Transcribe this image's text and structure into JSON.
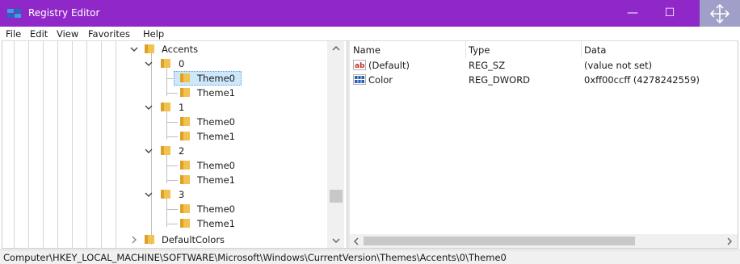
{
  "window": {
    "title": "Registry Editor",
    "accent_color": "#8f27c9",
    "controls": {
      "minimize": "—",
      "maximize": "☐"
    }
  },
  "menu": [
    "File",
    "Edit",
    "View",
    "Favorites",
    "Help"
  ],
  "tree": {
    "items": [
      {
        "label": "Accents",
        "depth": 0,
        "expanded": true
      },
      {
        "label": "0",
        "depth": 1,
        "expanded": true
      },
      {
        "label": "Theme0",
        "depth": 2,
        "selected": true
      },
      {
        "label": "Theme1",
        "depth": 2
      },
      {
        "label": "1",
        "depth": 1,
        "expanded": true
      },
      {
        "label": "Theme0",
        "depth": 2
      },
      {
        "label": "Theme1",
        "depth": 2
      },
      {
        "label": "2",
        "depth": 1,
        "expanded": true
      },
      {
        "label": "Theme0",
        "depth": 2
      },
      {
        "label": "Theme1",
        "depth": 2
      },
      {
        "label": "3",
        "depth": 1,
        "expanded": true
      },
      {
        "label": "Theme0",
        "depth": 2
      },
      {
        "label": "Theme1",
        "depth": 2
      },
      {
        "label": "DefaultColors",
        "depth": 0,
        "expanded": false
      }
    ]
  },
  "list": {
    "columns": [
      "Name",
      "Type",
      "Data"
    ],
    "rows": [
      {
        "icon": "string-value-icon",
        "name": "(Default)",
        "type": "REG_SZ",
        "data": "(value not set)"
      },
      {
        "icon": "binary-value-icon",
        "name": "Color",
        "type": "REG_DWORD",
        "data": "0xff00ccff (4278242559)"
      }
    ]
  },
  "status": {
    "path": "Computer\\HKEY_LOCAL_MACHINE\\SOFTWARE\\Microsoft\\Windows\\CurrentVersion\\Themes\\Accents\\0\\Theme0"
  }
}
